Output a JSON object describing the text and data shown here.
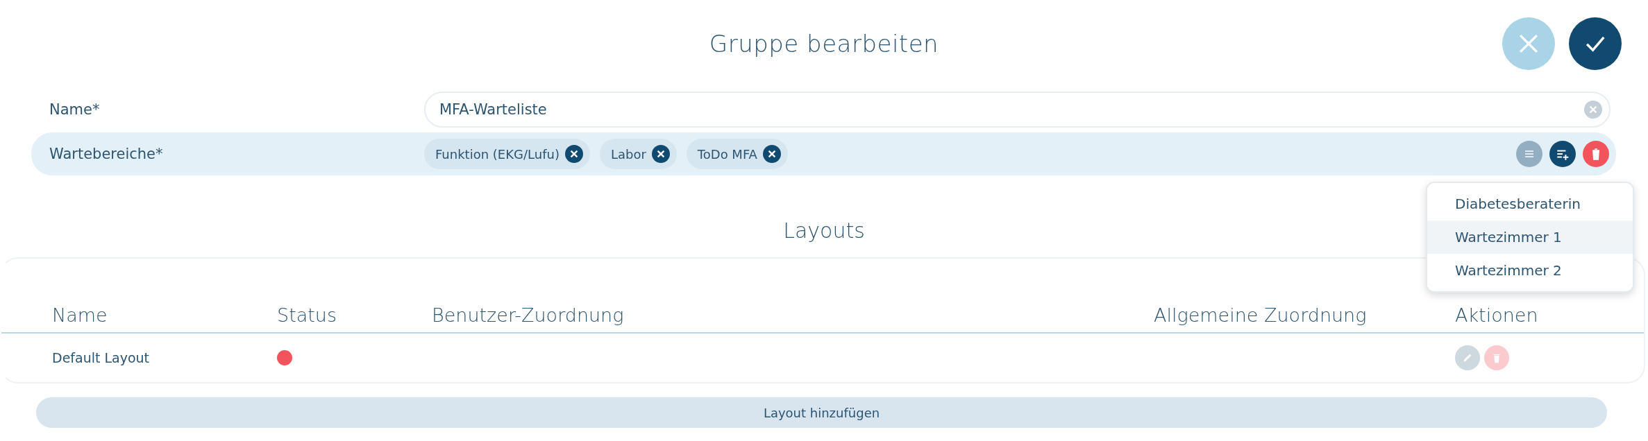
{
  "title": "Gruppe bearbeiten",
  "header_buttons": [
    {
      "kind": "cancel"
    },
    {
      "kind": "confirm"
    }
  ],
  "form": [
    {
      "kind": "input",
      "label": "Name*",
      "value": "MFA-Warteliste"
    },
    {
      "kind": "chips",
      "label": "Wartebereiche*",
      "chips": [
        "Funktion (EKG/Lufu)",
        "Labor",
        "ToDo MFA"
      ]
    }
  ],
  "dropdown": {
    "items": [
      {
        "label": "Diabetesberaterin",
        "selected": false
      },
      {
        "label": "Wartezimmer 1",
        "selected": true
      },
      {
        "label": "Wartezimmer 2",
        "selected": false
      }
    ]
  },
  "layouts": {
    "title": "Layouts",
    "columns": [
      "Name",
      "Status",
      "Benutzer-Zuordnung",
      "Allgemeine Zuordnung",
      "Aktionen"
    ],
    "rows": [
      {
        "name": "Default Layout",
        "color": "#f2545b",
        "actions_disabled": true
      }
    ],
    "add_button": "Layout hinzufügen"
  }
}
